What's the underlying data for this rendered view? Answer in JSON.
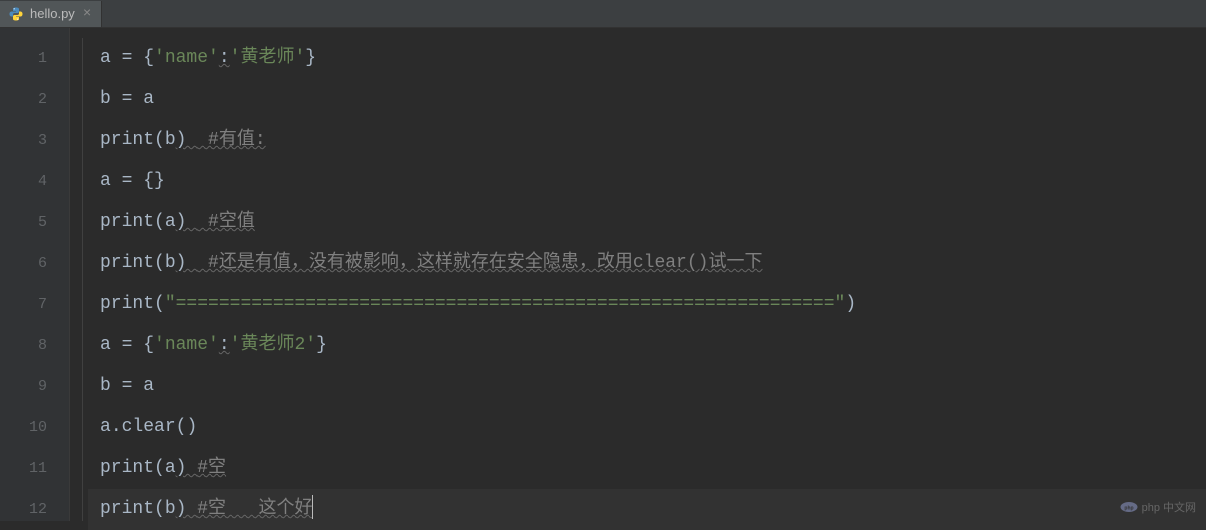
{
  "tab": {
    "filename": "hello.py",
    "close_symbol": "×"
  },
  "lines": {
    "l1": {
      "num": "1"
    },
    "l2": {
      "num": "2"
    },
    "l3": {
      "num": "3"
    },
    "l4": {
      "num": "4"
    },
    "l5": {
      "num": "5"
    },
    "l6": {
      "num": "6"
    },
    "l7": {
      "num": "7"
    },
    "l8": {
      "num": "8"
    },
    "l9": {
      "num": "9"
    },
    "l10": {
      "num": "10"
    },
    "l11": {
      "num": "11"
    },
    "l12": {
      "num": "12"
    }
  },
  "code": {
    "l1_var": "a ",
    "l1_eq": "= ",
    "l1_brace_open": "{",
    "l1_key": "'name'",
    "l1_colon": ":",
    "l1_val": "'黄老师'",
    "l1_brace_close": "}",
    "l2_var": "b ",
    "l2_eq": "= ",
    "l2_rhs": "a",
    "l3_fn": "print",
    "l3_paren_open": "(",
    "l3_arg": "b",
    "l3_paren_close": ") ",
    "l3_comment": " #有值:",
    "l4_var": "a ",
    "l4_eq": "= ",
    "l4_val": "{}",
    "l5_fn": "print",
    "l5_paren_open": "(",
    "l5_arg": "a",
    "l5_paren_close": ") ",
    "l5_comment": " #空值",
    "l6_fn": "print",
    "l6_paren_open": "(",
    "l6_arg": "b",
    "l6_paren_close": ") ",
    "l6_comment": " #还是有值，没有被影响，这样就存在安全隐患，改用clear()试一下",
    "l7_fn": "print",
    "l7_paren_open": "(",
    "l7_str": "\"=============================================================\"",
    "l7_paren_close": ")",
    "l8_var": "a ",
    "l8_eq": "= ",
    "l8_brace_open": "{",
    "l8_key": "'name'",
    "l8_colon": ":",
    "l8_val": "'黄老师2'",
    "l8_brace_close": "}",
    "l9_var": "b ",
    "l9_eq": "= ",
    "l9_rhs": "a",
    "l10_obj": "a",
    "l10_dot": ".",
    "l10_method": "clear",
    "l10_paren": "()",
    "l11_fn": "print",
    "l11_paren_open": "(",
    "l11_arg": "a",
    "l11_paren_close": ") ",
    "l11_comment": "#空",
    "l12_fn": "print",
    "l12_paren_open": "(",
    "l12_arg": "b",
    "l12_paren_close": ") ",
    "l12_comment": "#空   这个好"
  },
  "watermark": {
    "text": "php 中文网"
  }
}
